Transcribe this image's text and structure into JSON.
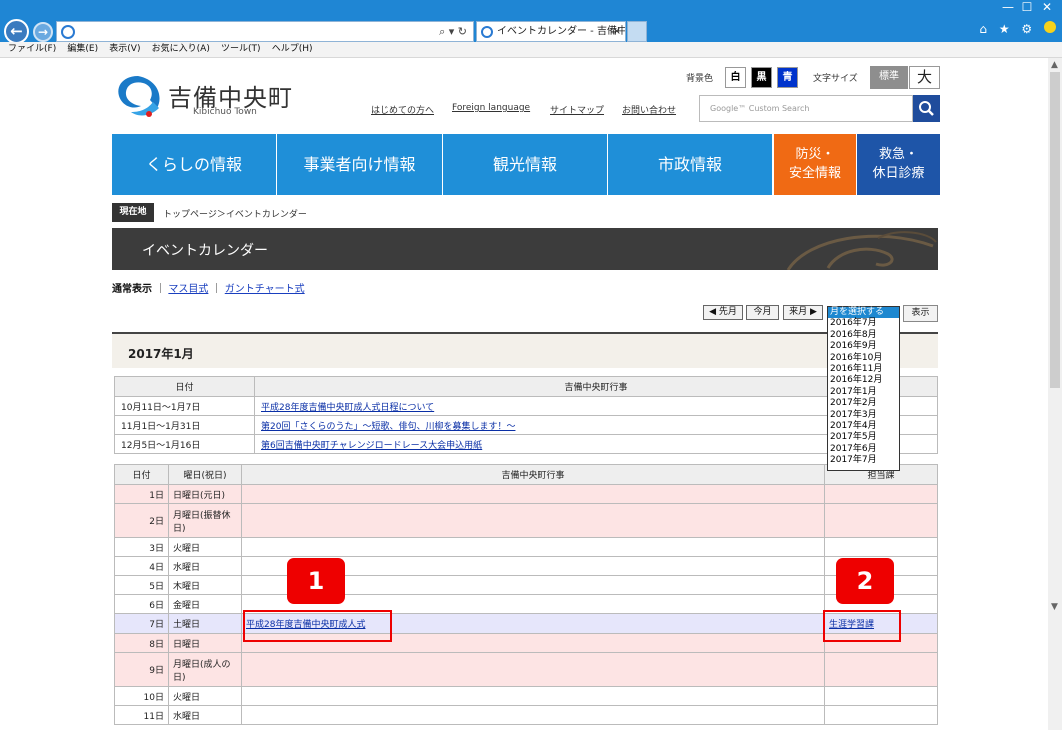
{
  "browser": {
    "tab_title": "イベントカレンダー - 吉備中央...",
    "tab_close": "×",
    "address_controls": "⌕ ▾ ↻",
    "window_controls": [
      "—",
      "☐",
      "✕"
    ],
    "toolbar_icons": "⌂ ★ ⚙",
    "menu": [
      "ファイル(F)",
      "編集(E)",
      "表示(V)",
      "お気に入り(A)",
      "ツール(T)",
      "ヘルプ(H)"
    ]
  },
  "header": {
    "logo_ja": "吉備中央町",
    "logo_en": "Kibichuo Town",
    "bg_color_label": "背景色",
    "bg_options": [
      "白",
      "黒",
      "青"
    ],
    "font_size_label": "文字サイズ",
    "font_standard": "標準",
    "font_large": "大",
    "links": [
      "はじめての方へ",
      "Foreign language",
      "サイトマップ",
      "お問い合わせ"
    ],
    "search_placeholder": "Google™ Custom Search"
  },
  "global_nav": [
    {
      "label": "くらしの情報",
      "color": "#1f8fd8"
    },
    {
      "label": "事業者向け情報",
      "color": "#1f8fd8"
    },
    {
      "label": "観光情報",
      "color": "#1f8fd8"
    },
    {
      "label": "市政情報",
      "color": "#1f8fd8"
    },
    {
      "label_line1": "防災・",
      "label_line2": "安全情報",
      "color": "#f06a14"
    },
    {
      "label_line1": "救急・",
      "label_line2": "休日診療",
      "color": "#1e55a8"
    }
  ],
  "breadcrumb": {
    "badge": "現在地",
    "path": "トップページ＞イベントカレンダー"
  },
  "banner_title": "イベントカレンダー",
  "view_modes": {
    "current": "通常表示",
    "sep": "｜",
    "links": [
      "マス目式",
      "ガントチャート式"
    ]
  },
  "controls": {
    "prev": "◀ 先月",
    "this": "今月",
    "next": "来月 ▶",
    "show": "表示",
    "month_options": [
      "月を選択する",
      "2016年7月",
      "2016年8月",
      "2016年9月",
      "2016年10月",
      "2016年11月",
      "2016年12月",
      "2017年1月",
      "2017年2月",
      "2017年3月",
      "2017年4月",
      "2017年5月",
      "2017年6月",
      "2017年7月"
    ]
  },
  "month_heading": "2017年1月",
  "long_events": {
    "headers": [
      "日付",
      "吉備中央町行事"
    ],
    "rows": [
      {
        "date": "10月11日～1月7日",
        "event": "平成28年度吉備中央町成人式日程について"
      },
      {
        "date": "11月1日～1月31日",
        "event": "第20回「さくらのうた」～短歌、俳句、川柳を募集します！～"
      },
      {
        "date": "12月5日～1月16日",
        "event": "第6回吉備中央町チャレンジロードレース大会申込用紙"
      }
    ]
  },
  "daily": {
    "headers": [
      "日付",
      "曜日(祝日)",
      "吉備中央町行事",
      "担当課"
    ],
    "rows": [
      {
        "day": "1日",
        "weekday": "日曜日(元日)",
        "event": "",
        "dept": ""
      },
      {
        "day": "2日",
        "weekday": "月曜日(振替休日)",
        "event": "",
        "dept": ""
      },
      {
        "day": "3日",
        "weekday": "火曜日",
        "event": "",
        "dept": ""
      },
      {
        "day": "4日",
        "weekday": "水曜日",
        "event": "",
        "dept": ""
      },
      {
        "day": "5日",
        "weekday": "木曜日",
        "event": "",
        "dept": ""
      },
      {
        "day": "6日",
        "weekday": "金曜日",
        "event": "",
        "dept": ""
      },
      {
        "day": "7日",
        "weekday": "土曜日",
        "event": "平成28年度吉備中央町成人式",
        "dept": "生涯学習課"
      },
      {
        "day": "8日",
        "weekday": "日曜日",
        "event": "",
        "dept": ""
      },
      {
        "day": "9日",
        "weekday": "月曜日(成人の日)",
        "event": "",
        "dept": ""
      },
      {
        "day": "10日",
        "weekday": "火曜日",
        "event": "",
        "dept": ""
      },
      {
        "day": "11日",
        "weekday": "水曜日",
        "event": "",
        "dept": ""
      }
    ]
  },
  "callouts": [
    "1",
    "2"
  ]
}
